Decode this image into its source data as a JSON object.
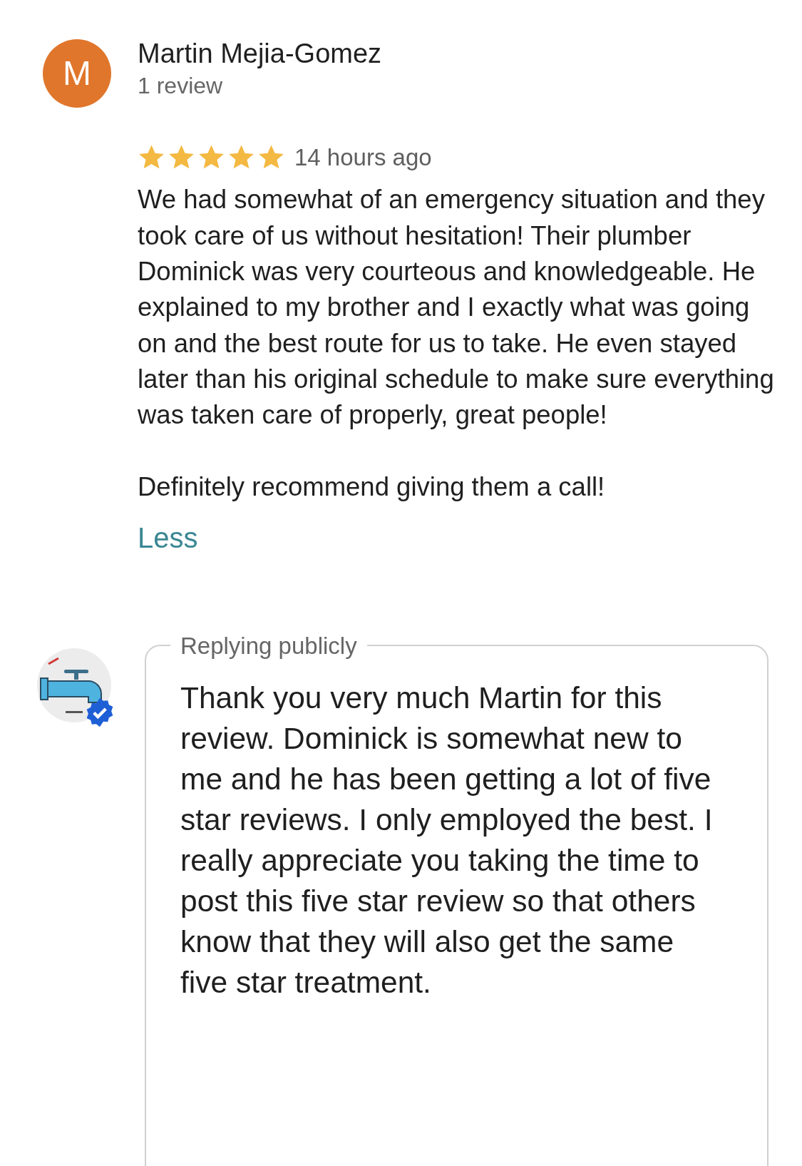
{
  "review": {
    "avatar_letter": "M",
    "author": "Martin Mejia-Gomez",
    "review_count": "1 review",
    "stars": 5,
    "time": "14 hours ago",
    "paragraphs": [
      "We had somewhat of an emergency situation and they took care of us without hesitation! Their plumber Dominick was very courteous and knowledgeable. He explained to my brother and I exactly what was going on and the best route for us to take. He even stayed later than his original schedule to make sure everything was taken care of properly, great people!",
      "Definitely recommend giving them a call!"
    ],
    "toggle": "Less"
  },
  "reply": {
    "avatar": {
      "kind": "picture",
      "verified": true
    },
    "label": "Replying publicly",
    "text": "Thank you very much Martin for this review. Dominick is somewhat new to me and he has been getting a lot of five star reviews. I only employed the best. I really appreciate you taking the time to post this five star review so that others know that they will also get the same five star treatment."
  }
}
